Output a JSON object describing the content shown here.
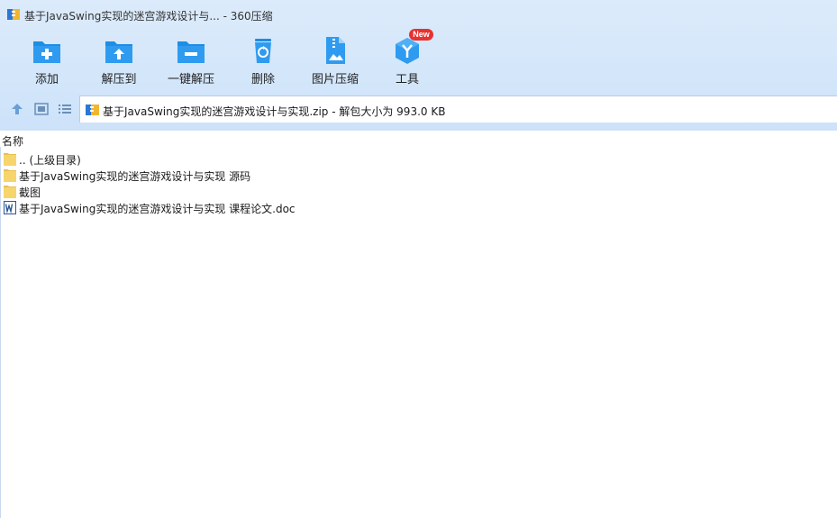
{
  "window": {
    "title": "基于JavaSwing实现的迷宫游戏设计与... - 360压缩"
  },
  "toolbar": {
    "items": [
      {
        "label": "添加",
        "icon": "folder-add-icon"
      },
      {
        "label": "解压到",
        "icon": "folder-extract-icon"
      },
      {
        "label": "一键解压",
        "icon": "folder-oneclick-extract-icon"
      },
      {
        "label": "删除",
        "icon": "recycle-bin-icon"
      },
      {
        "label": "图片压缩",
        "icon": "image-zip-icon"
      },
      {
        "label": "工具",
        "icon": "tools-cube-icon"
      }
    ],
    "new_badge": "New"
  },
  "addressbar": {
    "path": "基于JavaSwing实现的迷宫游戏设计与实现.zip - 解包大小为 993.0 KB"
  },
  "list": {
    "column_name": "名称",
    "files": [
      {
        "name": ".. (上级目录)",
        "type": "folder"
      },
      {
        "name": "基于JavaSwing实现的迷宫游戏设计与实现 源码",
        "type": "folder"
      },
      {
        "name": "截图",
        "type": "folder"
      },
      {
        "name": "基于JavaSwing实现的迷宫游戏设计与实现 课程论文.doc",
        "type": "word"
      }
    ]
  },
  "colors": {
    "accent": "#1e8de4",
    "header_bg": "#d3e6fa",
    "folder": "#f6d56d",
    "badge": "#e8322f"
  }
}
